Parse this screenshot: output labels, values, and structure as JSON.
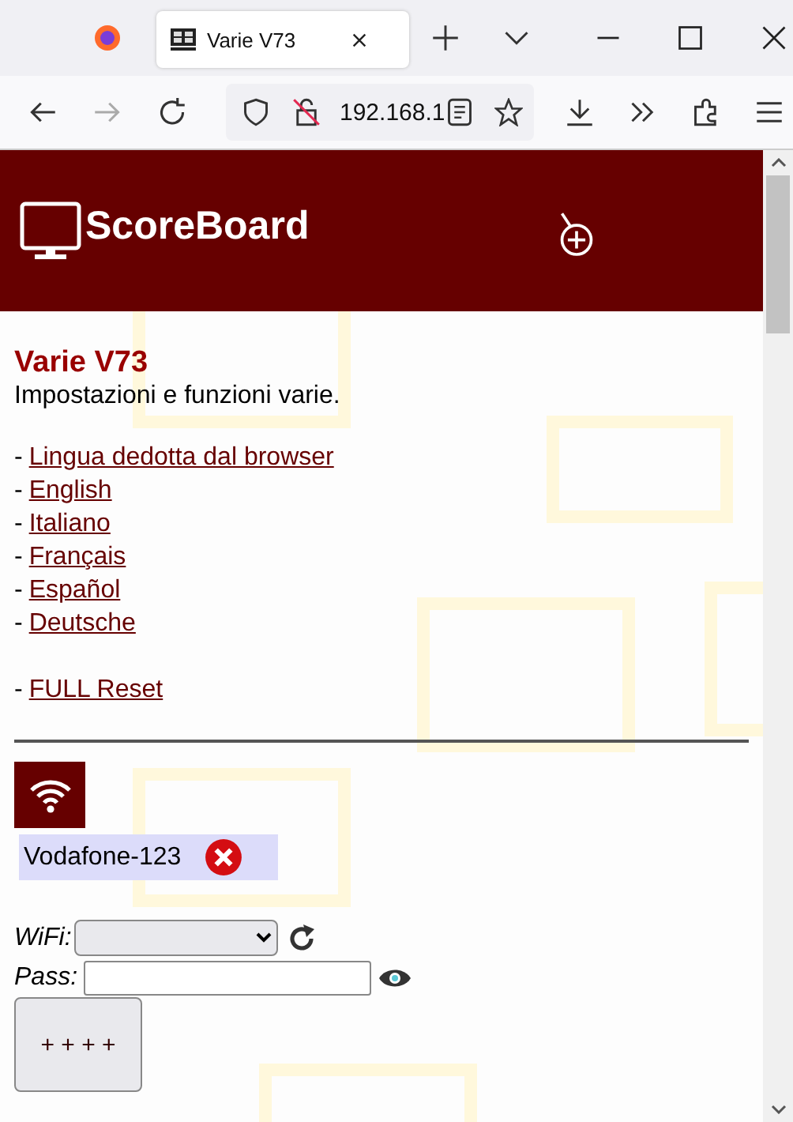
{
  "browser": {
    "tab_title": "Varie V73",
    "url": "192.168.1"
  },
  "header": {
    "title": "ScoreBoard"
  },
  "section": {
    "title": "Varie V73",
    "description": "Impostazioni e funzioni varie."
  },
  "link_groups": [
    [
      {
        "prefix": "-",
        "label": "Lingua dedotta dal browser"
      },
      {
        "prefix": "-",
        "label": "English"
      },
      {
        "prefix": "-",
        "label": "Italiano"
      },
      {
        "prefix": "-",
        "label": "Français"
      },
      {
        "prefix": "-",
        "label": "Español"
      },
      {
        "prefix": "-",
        "label": "Deutsche"
      }
    ],
    [
      {
        "prefix": "-",
        "label": "FULL Reset"
      }
    ]
  ],
  "wifi": {
    "network": "Vodafone-123",
    "wifi_label": "WiFi:",
    "pass_label": "Pass:",
    "button": "+ + + +"
  }
}
